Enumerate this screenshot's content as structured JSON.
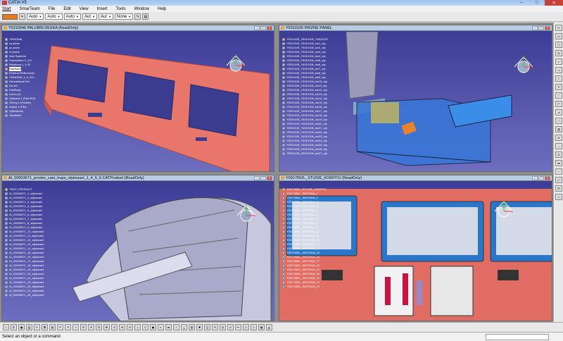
{
  "app": {
    "title": "CATIA V5"
  },
  "window_buttons": {
    "min": "–",
    "max": "□",
    "close": "✕"
  },
  "menu": [
    "Start",
    "SmarTeam",
    "File",
    "Edit",
    "View",
    "Insert",
    "Tools",
    "Window",
    "Help"
  ],
  "toolbar": {
    "color_swatch": "#e87a1e",
    "dropdowns": [
      "Auto",
      "Auto",
      "Auto",
      "Aut",
      "Aut",
      "None"
    ]
  },
  "windows": [
    {
      "title": "Y5310046 PALUBNI DESKA (ReadOnly)",
      "tree": [
        {
          "label": "Y5310046",
          "kind": "part"
        },
        {
          "label": "xy plane",
          "kind": "part"
        },
        {
          "label": "yz plane",
          "kind": "part"
        },
        {
          "label": "zx plane",
          "kind": "part"
        },
        {
          "label": "Axis Systems",
          "kind": "part"
        },
        {
          "label": "Parameters.1_5.0",
          "kind": "part"
        },
        {
          "label": "Relations.1_1.00",
          "kind": "part"
        },
        {
          "label": "Sandwich",
          "kind": "sel"
        },
        {
          "label": "External References",
          "kind": "part"
        },
        {
          "label": "Y5310046_1_0_NX...",
          "kind": "part"
        },
        {
          "label": "Geometrical Set",
          "kind": "part"
        },
        {
          "label": "Un.set",
          "kind": "part"
        },
        {
          "label": "PartBody",
          "kind": "part"
        },
        {
          "label": "rozvor pc",
          "kind": "part"
        },
        {
          "label": "Vytazeni.1 (Pad.004)",
          "kind": "part"
        },
        {
          "label": "Otvory.1 (Pocket)",
          "kind": "part"
        },
        {
          "label": "Kapsa.1 (Pkt)",
          "kind": "part"
        },
        {
          "label": "Hybridbody",
          "kind": "part"
        },
        {
          "label": "Sandwich",
          "kind": "part"
        }
      ]
    },
    {
      "title": "Y5310105 PRIZNE PANEL",
      "tree": [
        "Y5310105_Y5310106_Y5310107",
        "Y5310105_Y5310106_stz1_sty",
        "Y5310105_Y5310106_stz2_sty",
        "Y5310105_Y5310106_stz3_sty",
        "Y5310105_Y5310106_stz4_sty",
        "Y5310105_Y5310106_stz5_sty",
        "Y5310105_Y5310106_stz6_sty",
        "Y5310105_Y5310106_stz7_sty",
        "Y5310105_Y5310106_stz8_sty",
        "Y5310105_Y5310106_stz9_sty",
        "Y5310105_Y5310106_stz10_sty",
        "Y5310105_Y5310106_stz11_sty",
        "Y5310105_Y5310106_stz12_sty",
        "Y5310105_Y5310106_stz13_sty",
        "Y5310105_Y5310106_stz14_sty",
        "Y5310105_Y5310106_stz15_sty",
        "Y5310105_Y5310106_stz16_sty",
        "Y5310105_Y5310106_stz17_sty",
        "Y5310105_Y5310106_stz18_sty",
        "Y5310105_Y5310106_stz19_sty",
        "Y5310105_Y5310106_stz20_sty",
        "Y5310105_Y5310106_stz21_sty",
        "Y5310105_Y5310106_stz22_sty",
        "Y5310105_Y5310106_stz23_sty",
        "Y5310105_Y5310106_stz24_sty",
        "Y5310105_Y5310106_stz25_sty",
        "Y5310105_Y5310106_stz26_sty",
        "Y5310105_Y5310106_stz27_sty"
      ]
    },
    {
      "title": "AI_00003671_prostor_cast_trupu_stykovani_1_4_5_6.CATProduct (ReadOnly)",
      "tree": [
        "TRUP_PRODUCT",
        "AI_00003671_1_stykovani",
        "AI_00003671_2_stykovani",
        "AI_00003671_3_stykovani",
        "AI_00003671_4_stykovani",
        "AI_00003671_5_stykovani",
        "AI_00003671_6_stykovani",
        "AI_00003671_7_stykovani",
        "AI_00003671_8_stykovani",
        "AI_00003671_9_stykovani",
        "AI_00003671_10_stykovani",
        "AI_00003671_11_stykovani",
        "AI_00003671_12_stykovani",
        "AI_00003671_13_stykovani",
        "AI_00003671_14_stykovani",
        "AI_00003671_15_stykovani",
        "AI_00003671_16_stykovani",
        "AI_00003671_17_stykovani",
        "AI_00003671_18_stykovani",
        "AI_00003671_19_stykovani",
        "AI_00003671_20_stykovani",
        "AI_00003671_21_stykovani",
        "AI_00003671_22_stykovani",
        "AI_00003671_23_stykovani",
        "AI_00003671_24_stykovani",
        "AI_00003671_25_stykovani"
      ]
    },
    {
      "title": "Y0017552L_STUDIE_KOKPITU (ReadOnly)",
      "tree": [
        "Y0017552L_STUDIE_KOKPITU",
        "Y0017552L_SESTAVA_1",
        "Y0017552L_SESTAVA_2",
        "Y0017552L_SESTAVA_3",
        "Y0017552L_SESTAVA_4",
        "Y0017552L_SESTAVA_5",
        "Y0017552L_SESTAVA_6",
        "Y0017552L_SESTAVA_7",
        "Y0017552L_SESTAVA_8",
        "Y0017552L_SESTAVA_9",
        "Y0017552L_SESTAVA_10",
        "Y0017552L_SESTAVA_11",
        "Y0017552L_SESTAVA_12",
        "Y0017552L_SESTAVA_13",
        "Y0017552L_SESTAVA_14",
        "Y0017552L_SESTAVA_15",
        "Y0017552L_SESTAVA_16",
        "Y0017552L_SESTAVA_17",
        "Y0017552L_SESTAVA_18",
        "Y0017552L_SESTAVA_19",
        "Y0017552L_SESTAVA_20",
        "Y0017552L_SESTAVA_21",
        "Y0017552L_SESTAVA_22",
        "Y0017552L_SESTAVA_23"
      ]
    }
  ],
  "colors": {
    "viewport_top": "#3d3d96",
    "viewport_bottom": "#6e6ec0",
    "panel_salmon": "#e8766a",
    "accent_blue": "#3a76d6"
  },
  "status": {
    "message": "Select an object or a command"
  }
}
